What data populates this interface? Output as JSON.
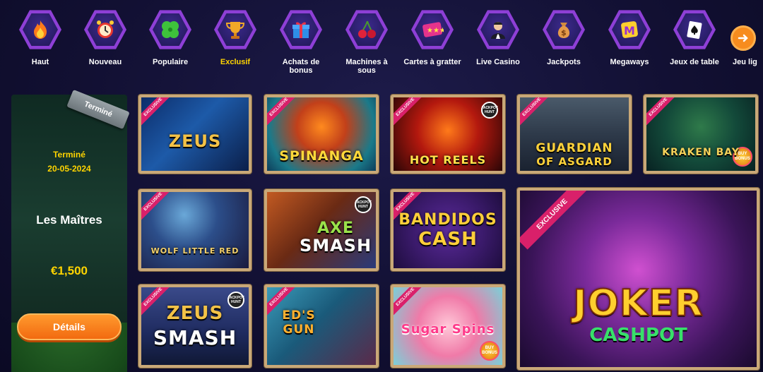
{
  "nav": {
    "categories": [
      {
        "label": "Haut",
        "icon": "flame-icon"
      },
      {
        "label": "Nouveau",
        "icon": "alarm-clock-icon"
      },
      {
        "label": "Populaire",
        "icon": "clover-icon"
      },
      {
        "label": "Exclusif",
        "icon": "trophy-icon",
        "active": true
      },
      {
        "label": "Achats de bonus",
        "icon": "gift-icon"
      },
      {
        "label": "Machines à sous",
        "icon": "cherries-icon"
      },
      {
        "label": "Cartes à gratter",
        "icon": "scratch-card-icon"
      },
      {
        "label": "Live Casino",
        "icon": "dealer-icon"
      },
      {
        "label": "Jackpots",
        "icon": "money-bag-icon"
      },
      {
        "label": "Megaways",
        "icon": "megaways-icon"
      },
      {
        "label": "Jeux de table",
        "icon": "playing-card-icon"
      },
      {
        "label": "Jeu lig",
        "icon": "partial-icon"
      }
    ],
    "next_icon": "arrow-right-icon"
  },
  "promo": {
    "ribbon": "Terminé",
    "status": "Terminé",
    "date": "20-05-2024",
    "title": "Les Maîtres",
    "prize": "€1,500",
    "button": "Détails"
  },
  "badges": {
    "exclusive": "EXCLUSIVE",
    "jackpot_hunt": "JACKPOT HUNT",
    "bonus": "BUY BONUS"
  },
  "games": {
    "zeus": "ZEUS",
    "spinanga": "SPINANGA",
    "hot_reels": "HOT REELS",
    "guardian_1": "GUARDIAN",
    "guardian_2": "OF ASGARD",
    "kraken": "KRAKEN BAY",
    "wolf": "WOLF LITTLE RED",
    "axe_1": "AXE",
    "axe_2": "SMASH",
    "bandidos_1": "BANDIDOS",
    "bandidos_2": "CASH",
    "zeus_smash_1": "ZEUS",
    "zeus_smash_2": "SMASH",
    "eds_gun": "ED'S GUN",
    "sugar_spins": "Sugar Spins",
    "joker_1": "JOKER",
    "joker_2": "CASHPOT"
  },
  "colors": {
    "accent_yellow": "#ffd400",
    "button_orange": "#f26a10",
    "hex_purple": "#8e3fd6",
    "frame_wood": "#c9a878",
    "exclusive_pink": "#d9206a"
  }
}
